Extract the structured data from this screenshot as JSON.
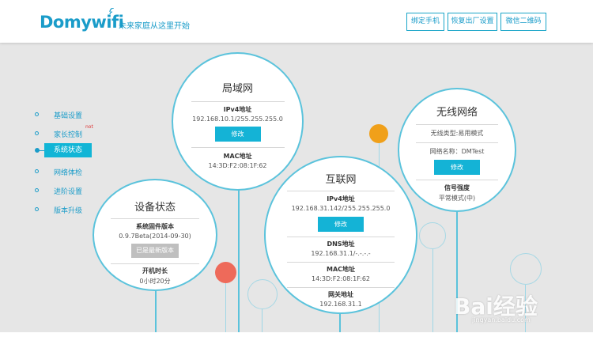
{
  "header": {
    "logo": "Domywifi",
    "slogan": "未来家庭从这里开始",
    "buttons": [
      "绑定手机",
      "恢复出厂设置",
      "微信二维码"
    ]
  },
  "sidebar": {
    "items": [
      {
        "label": "基础设置"
      },
      {
        "label": "家长控制",
        "badge": "not"
      },
      {
        "label": "系统状态",
        "active": true
      },
      {
        "label": "网络体检"
      },
      {
        "label": "进阶设置"
      },
      {
        "label": "版本升级"
      }
    ]
  },
  "lan": {
    "title": "局域网",
    "ipv4_label": "IPv4地址",
    "ipv4_value": "192.168.10.1/255.255.255.0",
    "modify": "修改",
    "mac_label": "MAC地址",
    "mac_value": "14:3D:F2:08:1F:62"
  },
  "device": {
    "title": "设备状态",
    "fw_label": "系统固件版本",
    "fw_value": "0.9.7Beta(2014-09-30)",
    "latest_button": "已是最新版本",
    "uptime_label": "开机时长",
    "uptime_value": "0小时20分"
  },
  "internet": {
    "title": "互联网",
    "ipv4_label": "IPv4地址",
    "ipv4_value": "192.168.31.142/255.255.255.0",
    "modify": "修改",
    "dns_label": "DNS地址",
    "dns_value": "192.168.31.1/-.-.-.-",
    "mac_label": "MAC地址",
    "mac_value": "14:3D:F2:08:1F:62",
    "gateway_label": "网关地址",
    "gateway_value": "192.168.31.1"
  },
  "wireless": {
    "title": "无线网络",
    "type_text": "无线类型:易用模式",
    "name_text": "网络名称：DMTest",
    "modify": "修改",
    "signal_label": "信号强度",
    "signal_value": "平常模式(中)"
  },
  "watermark": {
    "text": "Bai经验",
    "sub": "jingyan.baidu.com"
  },
  "colors": {
    "accent": "#14b3d6",
    "brand": "#1a9cc9",
    "orange": "#f0a01a",
    "red": "#ee6a5a",
    "background": "#e6e6e6"
  }
}
